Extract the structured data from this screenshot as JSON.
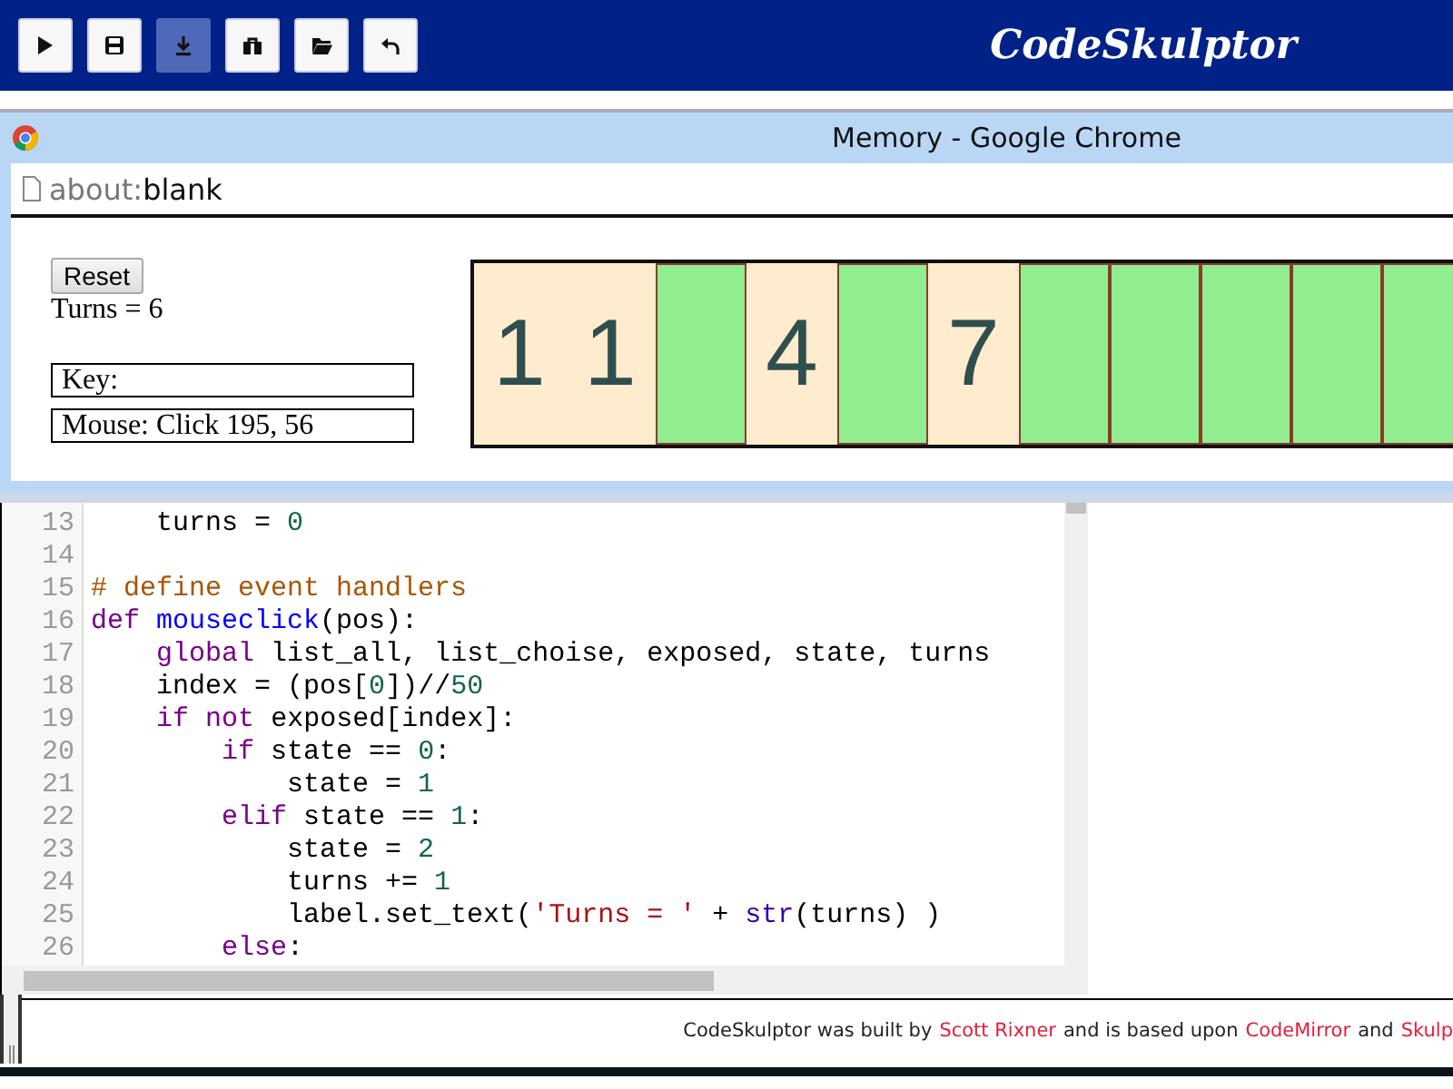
{
  "toolbar": {
    "buttons": [
      {
        "selected": false
      },
      {
        "selected": false
      },
      {
        "selected": true
      },
      {
        "selected": false
      },
      {
        "selected": false
      },
      {
        "selected": false
      }
    ],
    "title": "CodeSkulptor"
  },
  "browser": {
    "title": "Memory - Google Chrome",
    "address": {
      "scheme": "about:",
      "path": "blank"
    }
  },
  "game": {
    "reset_button": "Reset",
    "turns_label": "Turns = 6",
    "key_label": "Key:",
    "mouse_label": "Mouse: Click 195, 56",
    "cards": [
      {
        "exposed": true,
        "value": "1"
      },
      {
        "exposed": true,
        "value": "1"
      },
      {
        "exposed": false
      },
      {
        "exposed": true,
        "value": "4"
      },
      {
        "exposed": false
      },
      {
        "exposed": true,
        "value": "7"
      },
      {
        "exposed": false
      },
      {
        "exposed": false
      },
      {
        "exposed": false
      },
      {
        "exposed": false
      },
      {
        "exposed": false
      }
    ]
  },
  "editor": {
    "lines": [
      {
        "number": "13",
        "tokens": [
          {
            "kind": "plain",
            "text": "    turns = "
          },
          {
            "kind": "number",
            "text": "0"
          }
        ]
      },
      {
        "number": "14"
      },
      {
        "number": "15",
        "tokens": [
          {
            "kind": "comment",
            "text": "# define event handlers"
          }
        ]
      },
      {
        "number": "16",
        "tokens": [
          {
            "kind": "keyword",
            "text": "def"
          },
          {
            "kind": "def",
            "text": " mouseclick"
          },
          {
            "kind": "plain",
            "text": "(pos):"
          }
        ]
      },
      {
        "number": "17",
        "tokens": [
          {
            "kind": "keyword",
            "text": "    global"
          },
          {
            "kind": "plain",
            "text": " list_all, list_choise, exposed, state, turns"
          }
        ]
      },
      {
        "number": "18",
        "tokens": [
          {
            "kind": "plain",
            "text": "    index = (pos["
          },
          {
            "kind": "number",
            "text": "0"
          },
          {
            "kind": "plain",
            "text": "])//"
          },
          {
            "kind": "number",
            "text": "50"
          }
        ]
      },
      {
        "number": "19",
        "tokens": [
          {
            "kind": "keyword",
            "text": "    if"
          },
          {
            "kind": "keyword",
            "text": " not"
          },
          {
            "kind": "plain",
            "text": " exposed[index]:"
          }
        ]
      },
      {
        "number": "20",
        "tokens": [
          {
            "kind": "keyword",
            "text": "        if"
          },
          {
            "kind": "plain",
            "text": " state == "
          },
          {
            "kind": "number",
            "text": "0"
          },
          {
            "kind": "plain",
            "text": ":"
          }
        ]
      },
      {
        "number": "21",
        "tokens": [
          {
            "kind": "plain",
            "text": "            state = "
          },
          {
            "kind": "number",
            "text": "1"
          }
        ]
      },
      {
        "number": "22",
        "tokens": [
          {
            "kind": "keyword",
            "text": "        elif"
          },
          {
            "kind": "plain",
            "text": " state == "
          },
          {
            "kind": "number",
            "text": "1"
          },
          {
            "kind": "plain",
            "text": ":"
          }
        ]
      },
      {
        "number": "23",
        "tokens": [
          {
            "kind": "plain",
            "text": "            state = "
          },
          {
            "kind": "number",
            "text": "2"
          }
        ]
      },
      {
        "number": "24",
        "tokens": [
          {
            "kind": "plain",
            "text": "            turns += "
          },
          {
            "kind": "number",
            "text": "1"
          }
        ]
      },
      {
        "number": "25",
        "tokens": [
          {
            "kind": "plain",
            "text": "            label.set_text("
          },
          {
            "kind": "string",
            "text": "'Turns = '"
          },
          {
            "kind": "plain",
            "text": " + "
          },
          {
            "kind": "builtin",
            "text": "str"
          },
          {
            "kind": "plain",
            "text": "(turns) )"
          }
        ]
      },
      {
        "number": "26",
        "tokens": [
          {
            "kind": "keyword",
            "text": "        else"
          },
          {
            "kind": "plain",
            "text": ":"
          }
        ]
      }
    ]
  },
  "footer": [
    {
      "kind": "text",
      "text": "CodeSkulptor was built by"
    },
    {
      "kind": "link",
      "text": "Scott Rixner"
    },
    {
      "kind": "text",
      "text": "and is based upon"
    },
    {
      "kind": "link",
      "text": "CodeMirror"
    },
    {
      "kind": "text",
      "text": "and"
    },
    {
      "kind": "link",
      "text": "Skulp"
    }
  ]
}
